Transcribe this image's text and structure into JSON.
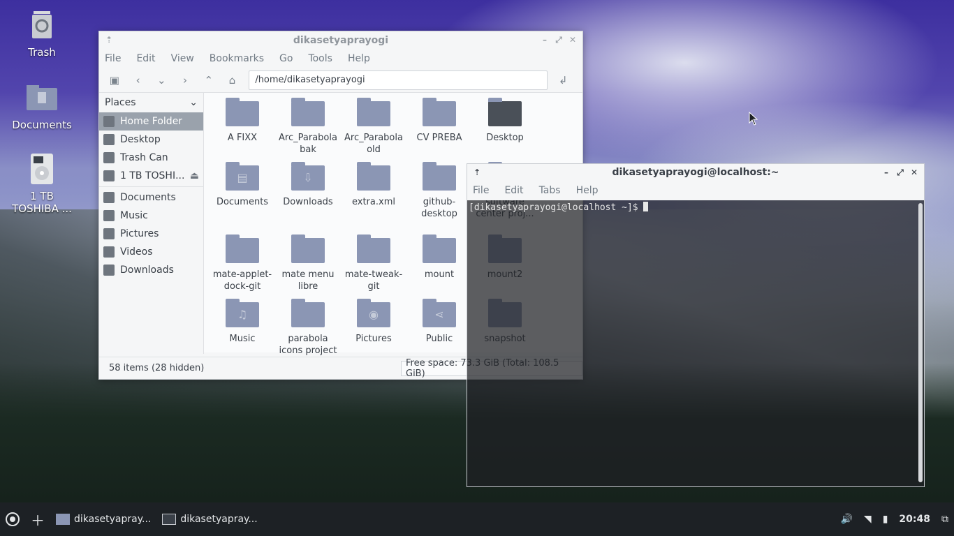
{
  "desktop": {
    "icons": [
      {
        "label": "Trash",
        "icon": "trash-icon"
      },
      {
        "label": "Documents",
        "icon": "folder-documents-icon"
      },
      {
        "label": "1 TB\nTOSHIBA ...",
        "icon": "drive-icon"
      }
    ]
  },
  "file_manager": {
    "title": "dikasetyaprayogi",
    "menu": [
      "File",
      "Edit",
      "View",
      "Bookmarks",
      "Go",
      "Tools",
      "Help"
    ],
    "location": "/home/dikasetyaprayogi",
    "sidebar": {
      "header": "Places",
      "items": [
        {
          "label": "Home Folder",
          "icon": "home-icon",
          "selected": true
        },
        {
          "label": "Desktop",
          "icon": "desktop-icon"
        },
        {
          "label": "Trash Can",
          "icon": "trash-icon"
        },
        {
          "label": "1 TB TOSHI...",
          "icon": "drive-icon"
        },
        {
          "label": "Documents",
          "icon": "documents-icon"
        },
        {
          "label": "Music",
          "icon": "music-icon"
        },
        {
          "label": "Pictures",
          "icon": "pictures-icon"
        },
        {
          "label": "Videos",
          "icon": "videos-icon"
        },
        {
          "label": "Downloads",
          "icon": "downloads-icon"
        }
      ]
    },
    "files": [
      {
        "name": "A FIXX",
        "type": "folder"
      },
      {
        "name": "Arc_Parabola\nbak",
        "type": "folder"
      },
      {
        "name": "Arc_Parabola\nold",
        "type": "folder"
      },
      {
        "name": "CV PREBA",
        "type": "folder"
      },
      {
        "name": "Desktop",
        "type": "folder-desktop"
      },
      {
        "name": "Documents",
        "type": "folder-documents"
      },
      {
        "name": "Downloads",
        "type": "folder-downloads"
      },
      {
        "name": "extra.xml",
        "type": "folder"
      },
      {
        "name": "github-\ndesktop",
        "type": "folder"
      },
      {
        "name": "software\ncenter proj...",
        "type": "folder"
      },
      {
        "name": "mate-applet-\ndock-git",
        "type": "folder"
      },
      {
        "name": "mate menu\nlibre",
        "type": "folder"
      },
      {
        "name": "mate-tweak-\ngit",
        "type": "folder"
      },
      {
        "name": "mount",
        "type": "folder"
      },
      {
        "name": "mount2",
        "type": "folder"
      },
      {
        "name": "Music",
        "type": "folder-music"
      },
      {
        "name": "parabola\nicons project",
        "type": "folder"
      },
      {
        "name": "Pictures",
        "type": "folder-pictures"
      },
      {
        "name": "Public",
        "type": "folder-public"
      },
      {
        "name": "snapshot",
        "type": "folder"
      }
    ],
    "status": "58 items (28 hidden)",
    "free_space": "Free space: 73.3 GiB (Total: 108.5 GiB)"
  },
  "terminal": {
    "title": "dikasetyaprayogi@localhost:~",
    "menu": [
      "File",
      "Edit",
      "Tabs",
      "Help"
    ],
    "prompt": "[dikasetyaprayogi@localhost ~]$ "
  },
  "taskbar": {
    "tasks": [
      "dikasetyapray...",
      "dikasetyapray..."
    ],
    "clock": "20:48"
  }
}
